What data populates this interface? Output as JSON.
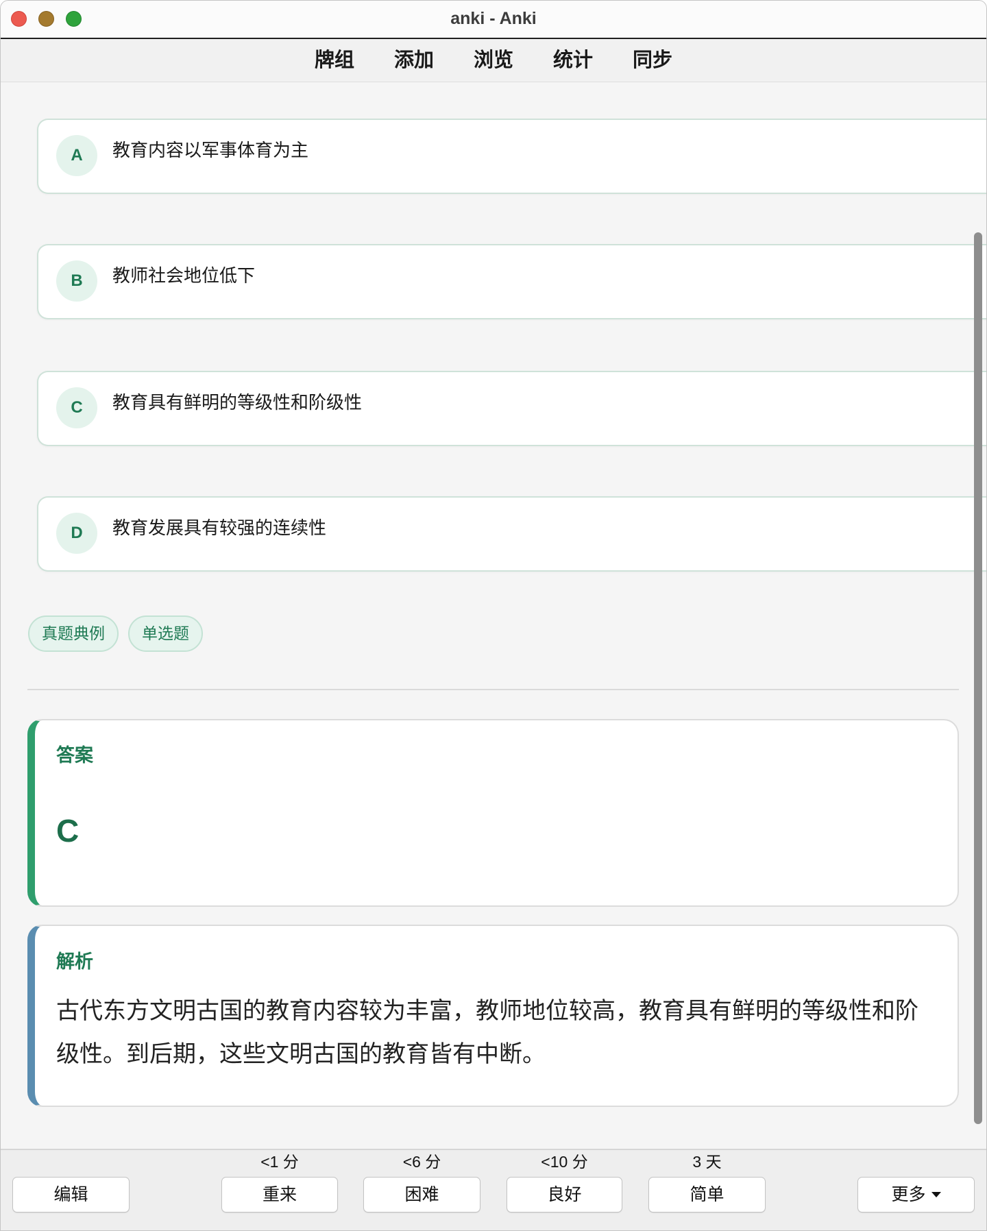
{
  "window": {
    "title": "anki - Anki",
    "controls": {
      "close_icon": "close-icon",
      "minimize_icon": "minimize-icon",
      "zoom_icon": "zoom-icon"
    }
  },
  "toolbar": {
    "items": [
      "牌组",
      "添加",
      "浏览",
      "统计",
      "同步"
    ]
  },
  "question": {
    "options": [
      {
        "letter": "A",
        "text": "教育内容以军事体育为主"
      },
      {
        "letter": "B",
        "text": "教师社会地位低下"
      },
      {
        "letter": "C",
        "text": "教育具有鲜明的等级性和阶级性"
      },
      {
        "letter": "D",
        "text": "教育发展具有较强的连续性"
      }
    ],
    "tags": [
      "真题典例",
      "单选题"
    ]
  },
  "answer": {
    "label": "答案",
    "value": "C"
  },
  "analysis": {
    "label": "解析",
    "text": "古代东方文明古国的教育内容较为丰富，教师地位较高，教育具有鲜明的等级性和阶级性。到后期，这些文明古国的教育皆有中断。"
  },
  "review_bar": {
    "edit_label": "编辑",
    "ease_buttons": [
      {
        "interval": "<1 分",
        "label": "重来"
      },
      {
        "interval": "<6 分",
        "label": "困难"
      },
      {
        "interval": "<10 分",
        "label": "良好"
      },
      {
        "interval": "3 天",
        "label": "简单"
      }
    ],
    "more_label": "更多",
    "more_icon": "caret-down-icon"
  },
  "colors": {
    "accent_green": "#1f7a54",
    "answer_accent": "#2f9e6d",
    "analysis_accent": "#5a8db0",
    "option_border": "#cfe2d9",
    "tag_background": "#e6f4ee"
  }
}
